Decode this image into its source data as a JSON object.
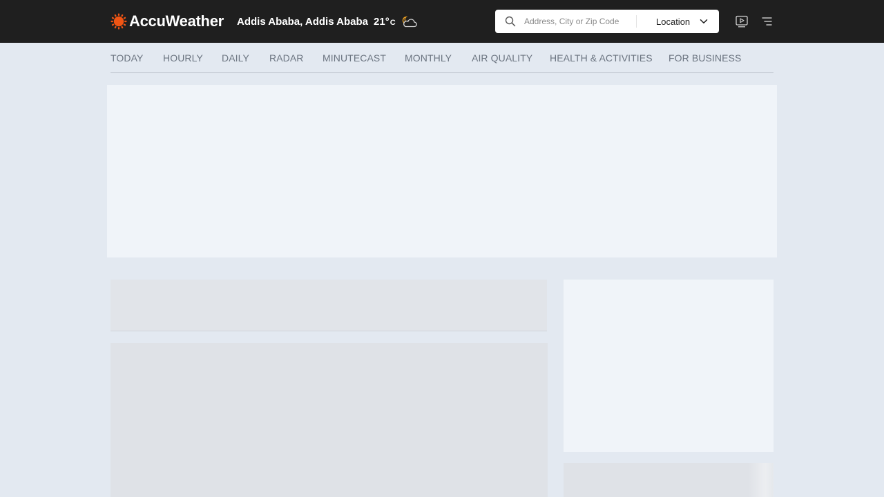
{
  "header": {
    "brand": "AccuWeather",
    "location_name": "Addis Ababa, Addis Ababa",
    "temperature": "21°",
    "temperature_unit": "C",
    "weather_icon": "partly-cloudy-night-icon",
    "brand_color": "#f05514"
  },
  "search": {
    "placeholder": "Address, City or Zip Code",
    "location_button_label": "Location"
  },
  "icons": {
    "video": "video-icon",
    "menu": "menu-icon"
  },
  "subnav": {
    "items": [
      {
        "label": "TODAY"
      },
      {
        "label": "HOURLY"
      },
      {
        "label": "DAILY"
      },
      {
        "label": "RADAR"
      },
      {
        "label": "MINUTECAST"
      },
      {
        "label": "MONTHLY"
      },
      {
        "label": "AIR QUALITY"
      },
      {
        "label": "HEALTH & ACTIVITIES"
      },
      {
        "label": "FOR BUSINESS"
      }
    ]
  }
}
